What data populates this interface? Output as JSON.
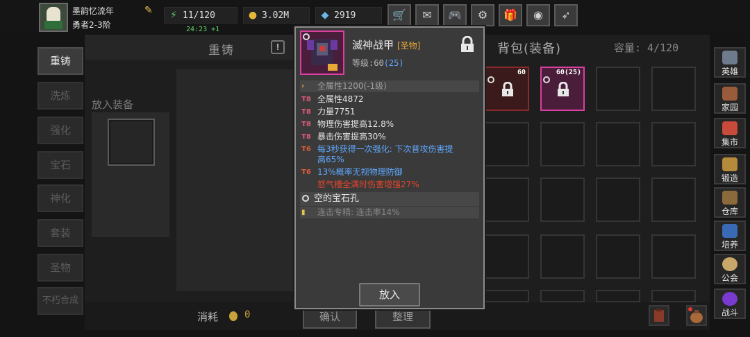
{
  "player": {
    "name": "墨韵忆流年",
    "rank": "勇者2-3阶"
  },
  "resources": {
    "energy": "11/120",
    "energy_timer": "24:23 +1",
    "gold": "3.02M",
    "gems": "2919"
  },
  "top_buttons": [
    "shop-cart-icon",
    "mail-icon",
    "gamepad-icon",
    "settings-gear-icon",
    "gift-icon",
    "color-wheel-icon",
    "feather-icon"
  ],
  "left_tabs": [
    {
      "label": "重铸",
      "active": true
    },
    {
      "label": "洗炼",
      "active": false
    },
    {
      "label": "强化",
      "active": false
    },
    {
      "label": "宝石",
      "active": false
    },
    {
      "label": "神化",
      "active": false
    },
    {
      "label": "套装",
      "active": false
    },
    {
      "label": "圣物",
      "active": false
    },
    {
      "label": "不朽合成",
      "active": false
    }
  ],
  "recast": {
    "title": "重铸",
    "place_label": "放入装备"
  },
  "bag": {
    "title": "背包(装备)",
    "capacity_label": "容量: 4/120",
    "items": [
      {
        "count": "60",
        "frame": "red"
      },
      {
        "count": "60(25)",
        "frame": "pink"
      }
    ]
  },
  "bottom": {
    "consume_label": "消耗",
    "consume_value": "0",
    "confirm_label": "确认",
    "sort_label": "整理"
  },
  "right_nav": [
    {
      "label": "英雄",
      "color": "#6e7b8c"
    },
    {
      "label": "家园",
      "color": "#9a5b3a"
    },
    {
      "label": "集市",
      "color": "#c84a3a"
    },
    {
      "label": "锻造",
      "color": "#b58a3a"
    },
    {
      "label": "仓库",
      "color": "#8a6a3a"
    },
    {
      "label": "培养",
      "color": "#3a6ab5"
    },
    {
      "label": "公会",
      "color": "#c8a86a"
    },
    {
      "label": "战斗",
      "color": "#7a3ad0"
    }
  ],
  "tooltip": {
    "name": "滅神战甲",
    "tag": "[圣物]",
    "level_label": "等级:60",
    "level_bonus": "(25)",
    "base_stat": "全属性1200(-1级)",
    "stats": [
      {
        "tier": "T8",
        "text": "全属性4872",
        "color": "#e4e4e4"
      },
      {
        "tier": "T8",
        "text": "力量7751",
        "color": "#e4e4e4"
      },
      {
        "tier": "T8",
        "text": "物理伤害提高12.8%",
        "color": "#e4e4e4"
      },
      {
        "tier": "T8",
        "text": "暴击伤害提高30%",
        "color": "#e4e4e4"
      },
      {
        "tier": "T6",
        "text": "每3秒获得一次强化: 下次普攻伤害提",
        "color": "#5fa8ff"
      },
      {
        "tier": "",
        "text": "高65%",
        "color": "#5fa8ff"
      },
      {
        "tier": "T6",
        "text": "13%概率无视物理防御",
        "color": "#5fa8ff"
      },
      {
        "tier": "",
        "text": "怒气槽全满时伤害增强27%",
        "color": "#e0452c"
      }
    ],
    "gem_slot": "空的宝石孔",
    "combo": "连击专精: 连击率14%",
    "put_button": "放入"
  }
}
